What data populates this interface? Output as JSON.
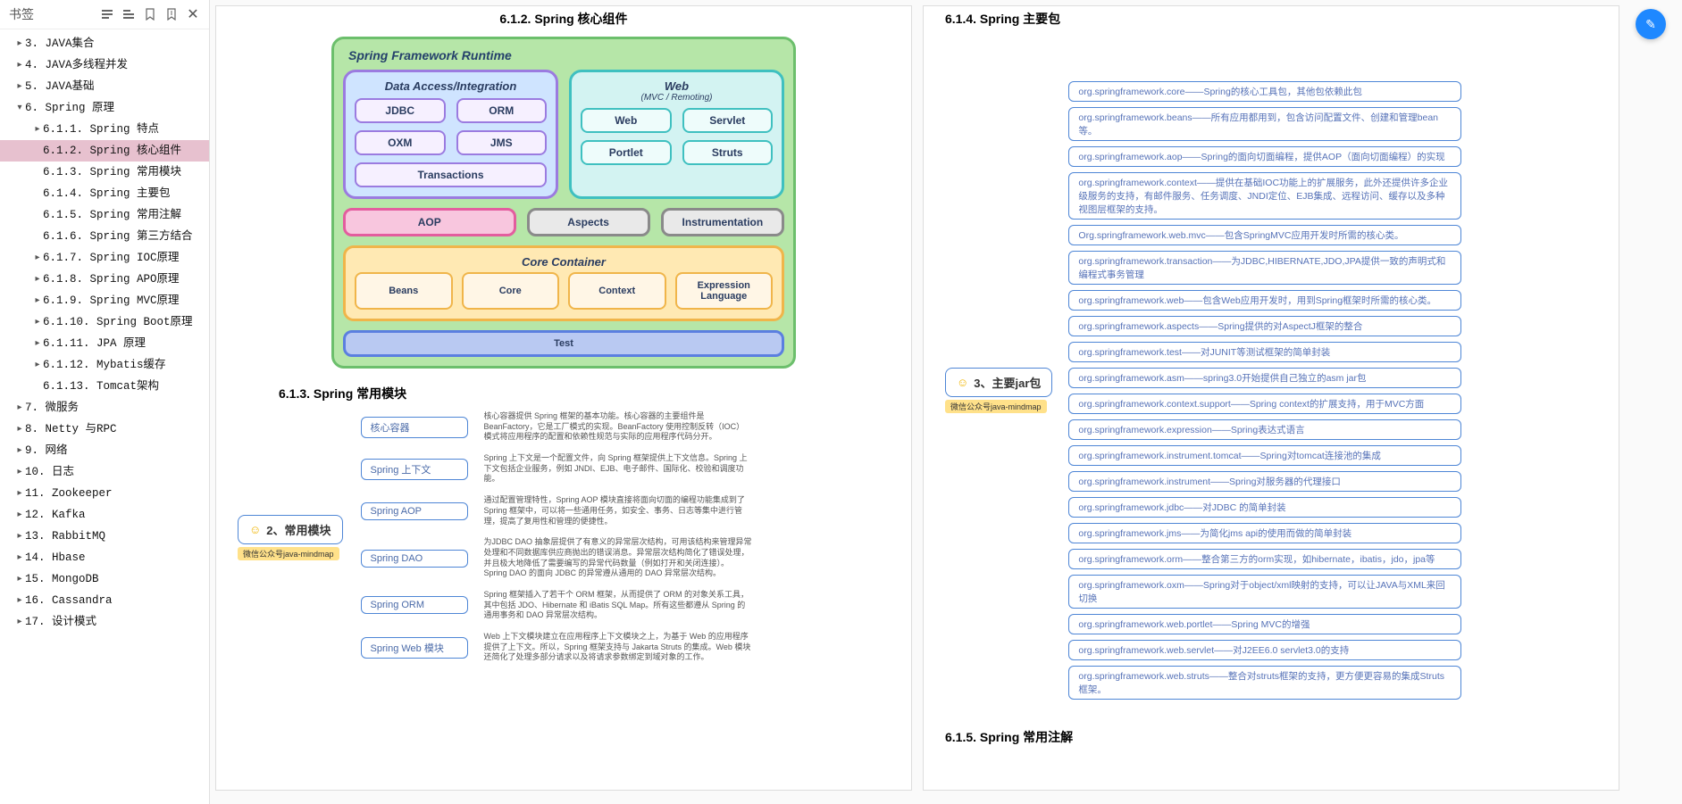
{
  "sidebar": {
    "title": "书签",
    "close_glyph": "✕",
    "items": [
      {
        "level": 1,
        "caret": "▸",
        "label": "3. JAVA集合"
      },
      {
        "level": 1,
        "caret": "▸",
        "label": "4. JAVA多线程并发"
      },
      {
        "level": 1,
        "caret": "▸",
        "label": "5. JAVA基础"
      },
      {
        "level": 1,
        "caret": "▾",
        "label": "6. Spring 原理"
      },
      {
        "level": 2,
        "caret": "▸",
        "label": "6.1.1. Spring 特点"
      },
      {
        "level": 2,
        "caret": "",
        "label": "6.1.2. Spring 核心组件",
        "sel": true
      },
      {
        "level": 2,
        "caret": "",
        "label": "6.1.3. Spring 常用模块"
      },
      {
        "level": 2,
        "caret": "",
        "label": "6.1.4. Spring 主要包"
      },
      {
        "level": 2,
        "caret": "",
        "label": "6.1.5. Spring 常用注解"
      },
      {
        "level": 2,
        "caret": "",
        "label": "6.1.6. Spring 第三方结合"
      },
      {
        "level": 2,
        "caret": "▸",
        "label": "6.1.7. Spring IOC原理"
      },
      {
        "level": 2,
        "caret": "▸",
        "label": "6.1.8. Spring APO原理"
      },
      {
        "level": 2,
        "caret": "▸",
        "label": "6.1.9. Spring MVC原理"
      },
      {
        "level": 2,
        "caret": "▸",
        "label": "6.1.10. Spring Boot原理"
      },
      {
        "level": 2,
        "caret": "▸",
        "label": "6.1.11. JPA 原理"
      },
      {
        "level": 2,
        "caret": "▸",
        "label": "6.1.12. Mybatis缓存"
      },
      {
        "level": 2,
        "caret": "",
        "label": "6.1.13. Tomcat架构"
      },
      {
        "level": 1,
        "caret": "▸",
        "label": "7.  微服务"
      },
      {
        "level": 1,
        "caret": "▸",
        "label": "8. Netty 与RPC"
      },
      {
        "level": 1,
        "caret": "▸",
        "label": "9. 网络"
      },
      {
        "level": 1,
        "caret": "▸",
        "label": "10. 日志"
      },
      {
        "level": 1,
        "caret": "▸",
        "label": "11. Zookeeper"
      },
      {
        "level": 1,
        "caret": "▸",
        "label": "12. Kafka"
      },
      {
        "level": 1,
        "caret": "▸",
        "label": "13. RabbitMQ"
      },
      {
        "level": 1,
        "caret": "▸",
        "label": "14. Hbase"
      },
      {
        "level": 1,
        "caret": "▸",
        "label": "15. MongoDB"
      },
      {
        "level": 1,
        "caret": "▸",
        "label": "16. Cassandra"
      },
      {
        "level": 1,
        "caret": "▸",
        "label": "17. 设计模式"
      }
    ]
  },
  "sec612": {
    "title": "6.1.2.  Spring 核心组件",
    "runtime": {
      "frame_title": "Spring Framework Runtime",
      "data_group": {
        "title": "Data Access/Integration",
        "mods": [
          "JDBC",
          "ORM",
          "OXM",
          "JMS"
        ],
        "wide": "Transactions"
      },
      "web_group": {
        "title": "Web",
        "sub": "(MVC / Remoting)",
        "mods": [
          "Web",
          "Servlet",
          "Portlet",
          "Struts"
        ]
      },
      "aop_row": [
        "AOP",
        "Aspects",
        "Instrumentation"
      ],
      "core_group": {
        "title": "Core Container",
        "mods": [
          "Beans",
          "Core",
          "Context",
          "Expression Language"
        ]
      },
      "test": "Test"
    }
  },
  "sec613": {
    "title": "6.1.3.  Spring 常用模块",
    "root": "2、常用模块",
    "source": "微信公众号java-mindmap",
    "rows": [
      {
        "node": "核心容器",
        "desc": "核心容器提供 Spring 框架的基本功能。核心容器的主要组件是 BeanFactory，它是工厂模式的实现。BeanFactory 使用控制反转（IOC）模式将应用程序的配置和依赖性规范与实际的应用程序代码分开。"
      },
      {
        "node": "Spring 上下文",
        "desc": "Spring 上下文是一个配置文件，向 Spring 框架提供上下文信息。Spring 上下文包括企业服务，例如 JNDI、EJB、电子邮件、国际化、校验和调度功能。"
      },
      {
        "node": "Spring AOP",
        "desc": "通过配置管理特性，Spring AOP 模块直接将面向切面的编程功能集成到了 Spring 框架中，可以将一些通用任务，如安全、事务、日志等集中进行管理，提高了复用性和管理的便捷性。"
      },
      {
        "node": "Spring DAO",
        "desc": "为JDBC DAO 抽象层提供了有意义的异常层次结构，可用该结构来管理异常处理和不同数据库供应商抛出的错误消息。异常层次结构简化了错误处理，并且极大地降低了需要编写的异常代码数量（例如打开和关闭连接）。Spring DAO 的面向 JDBC 的异常遵从通用的 DAO 异常层次结构。"
      },
      {
        "node": "Spring ORM",
        "desc": "Spring 框架插入了若干个 ORM 框架，从而提供了 ORM 的对象关系工具，其中包括 JDO、Hibernate 和 iBatis SQL Map。所有这些都遵从 Spring 的通用事务和 DAO 异常层次结构。"
      },
      {
        "node": "Spring Web 模块",
        "desc": "Web 上下文模块建立在应用程序上下文模块之上，为基于 Web 的应用程序提供了上下文。所以，Spring 框架支持与 Jakarta Struts 的集成。Web 模块还简化了处理多部分请求以及将请求参数绑定到域对象的工作。"
      }
    ]
  },
  "sec614": {
    "title": "6.1.4.  Spring 主要包",
    "root": "3、主要jar包",
    "source": "微信公众号java-mindmap",
    "items": [
      "org.springframework.core——Spring的核心工具包，其他包依赖此包",
      "org.springframework.beans——所有应用都用到，包含访问配置文件、创建和管理bean等。",
      "org.springframework.aop——Spring的面向切面编程，提供AOP（面向切面编程）的实现",
      "org.springframework.context——提供在基础IOC功能上的扩展服务，此外还提供许多企业级服务的支持，有邮件服务、任务调度、JNDI定位、EJB集成、远程访问、缓存以及多种视图层框架的支持。",
      "Org.springframework.web.mvc——包含SpringMVC应用开发时所需的核心类。",
      "org.springframework.transaction——为JDBC,HIBERNATE,JDO,JPA提供一致的声明式和编程式事务管理",
      "org.springframework.web——包含Web应用开发时，用到Spring框架时所需的核心类。",
      "org.springframework.aspects——Spring提供的对AspectJ框架的整合",
      "org.springframework.test——对JUNIT等测试框架的简单封装",
      "org.springframework.asm——spring3.0开始提供自己独立的asm jar包",
      "org.springframework.context.support——Spring context的扩展支持，用于MVC方面",
      "org.springframework.expression——Spring表达式语言",
      "org.springframework.instrument.tomcat——Spring对tomcat连接池的集成",
      "org.springframework.instrument——Spring对服务器的代理接口",
      "org.springframework.jdbc——对JDBC 的简单封装",
      "org.springframework.jms——为简化jms api的使用而做的简单封装",
      "org.springframework.orm——整合第三方的orm实现，如hibernate，ibatis，jdo，jpa等",
      "org.springframework.oxm——Spring对于object/xml映射的支持，可以让JAVA与XML来回切换",
      "org.springframework.web.portlet——Spring MVC的增强",
      "org.springframework.web.servlet——对J2EE6.0 servlet3.0的支持",
      "org.springframework.web.struts——整合对struts框架的支持，更方便更容易的集成Struts框架。"
    ]
  },
  "sec615": {
    "title": "6.1.5.  Spring 常用注解"
  },
  "fab_glyph": "✎"
}
